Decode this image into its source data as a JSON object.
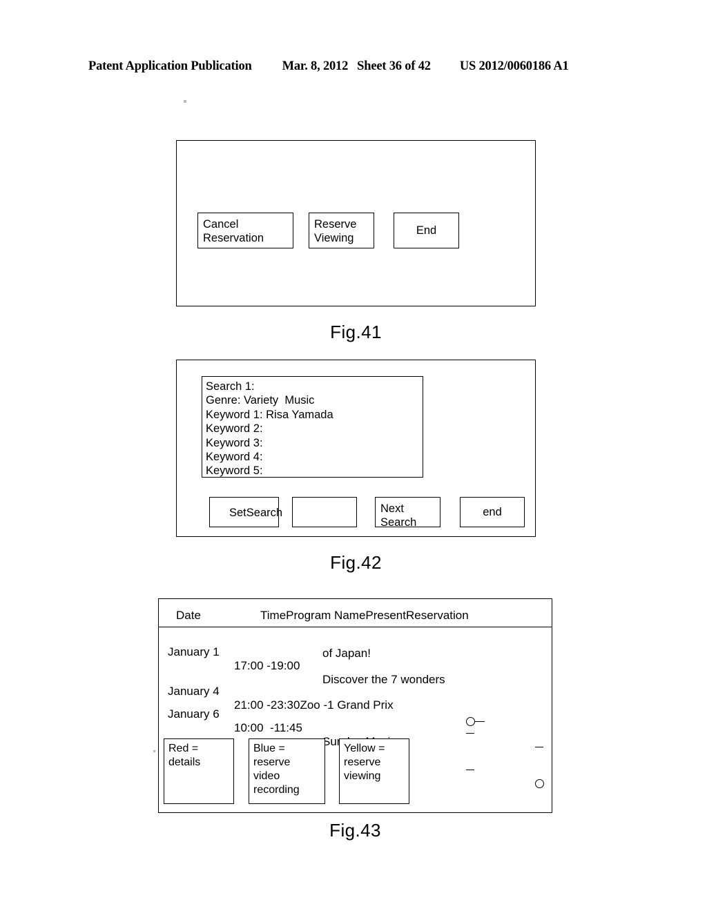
{
  "page_header": {
    "publication": "Patent Application Publication",
    "date": "Mar. 8, 2012",
    "sheet": "Sheet 36 of 42",
    "document_number": "US 2012/0060186 A1"
  },
  "fig41": {
    "caption": "Fig.41",
    "buttons": [
      {
        "label": "Cancel\nReservation",
        "align": "left"
      },
      {
        "label": "Reserve\nViewing",
        "align": "left"
      },
      {
        "label": "End",
        "align": "center"
      }
    ]
  },
  "fig42": {
    "caption": "Fig.42",
    "search_panel": {
      "lines": [
        "Search 1:",
        "Genre: Variety  Music",
        "Keyword 1: Risa Yamada",
        "Keyword 2:",
        "Keyword 3:",
        "Keyword 4:",
        "Keyword 5:"
      ]
    },
    "buttons": [
      {
        "label": "SetSearch"
      },
      {
        "label": ""
      },
      {
        "label": "Next\nSearch"
      },
      {
        "label": "end"
      }
    ]
  },
  "fig43": {
    "caption": "Fig.43",
    "table": {
      "header_date": "Date",
      "header_rest": "TimeProgram NamePresentReservation",
      "columns": [
        "Date",
        "Time",
        "Program Name",
        "Present",
        "Reservation"
      ],
      "rows": [
        {
          "date": "January 1",
          "time": "17:00 -19:00",
          "program": "Discover the 7 wonders",
          "program_line2": "of Japan!",
          "present": "circle-dash",
          "reservation": ""
        },
        {
          "date": "January 4",
          "time": "21:00 -23:30Zoo -1 Grand Prix",
          "program": "",
          "program_line2": "",
          "present": "dash",
          "reservation": "dash"
        },
        {
          "date": "January 6",
          "time": "10:00  -11:45",
          "program": "Sunday Music",
          "program_line2": "",
          "present": "dash",
          "reservation": "circle"
        }
      ]
    },
    "legend": [
      {
        "label": "Red =\ndetails"
      },
      {
        "label": "Blue =\nreserve\nvideo\nrecording"
      },
      {
        "label": "Yellow =\nreserve\nviewing"
      }
    ]
  }
}
